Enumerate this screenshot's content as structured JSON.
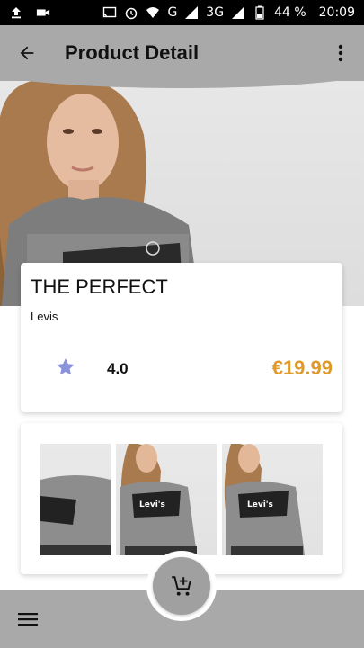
{
  "status_bar": {
    "battery": "44 %",
    "time": "20:09",
    "network": "3G",
    "carrier": "G"
  },
  "app_bar": {
    "title": "Product Detail",
    "back_icon": "arrow-back-icon",
    "more_icon": "more-vert-icon"
  },
  "product": {
    "name": "THE PERFECT",
    "brand": "Levis",
    "rating": "4.0",
    "price": "€19.99",
    "price_color": "#e09a2a",
    "star_color": "#8a93d9"
  },
  "gallery": {
    "images": [
      "product-photo-1",
      "product-photo-2",
      "product-photo-3"
    ],
    "logo_text": "Levi's"
  },
  "bottom_bar": {
    "menu_icon": "hamburger-menu-icon",
    "fab_icon": "add-to-cart-icon"
  }
}
